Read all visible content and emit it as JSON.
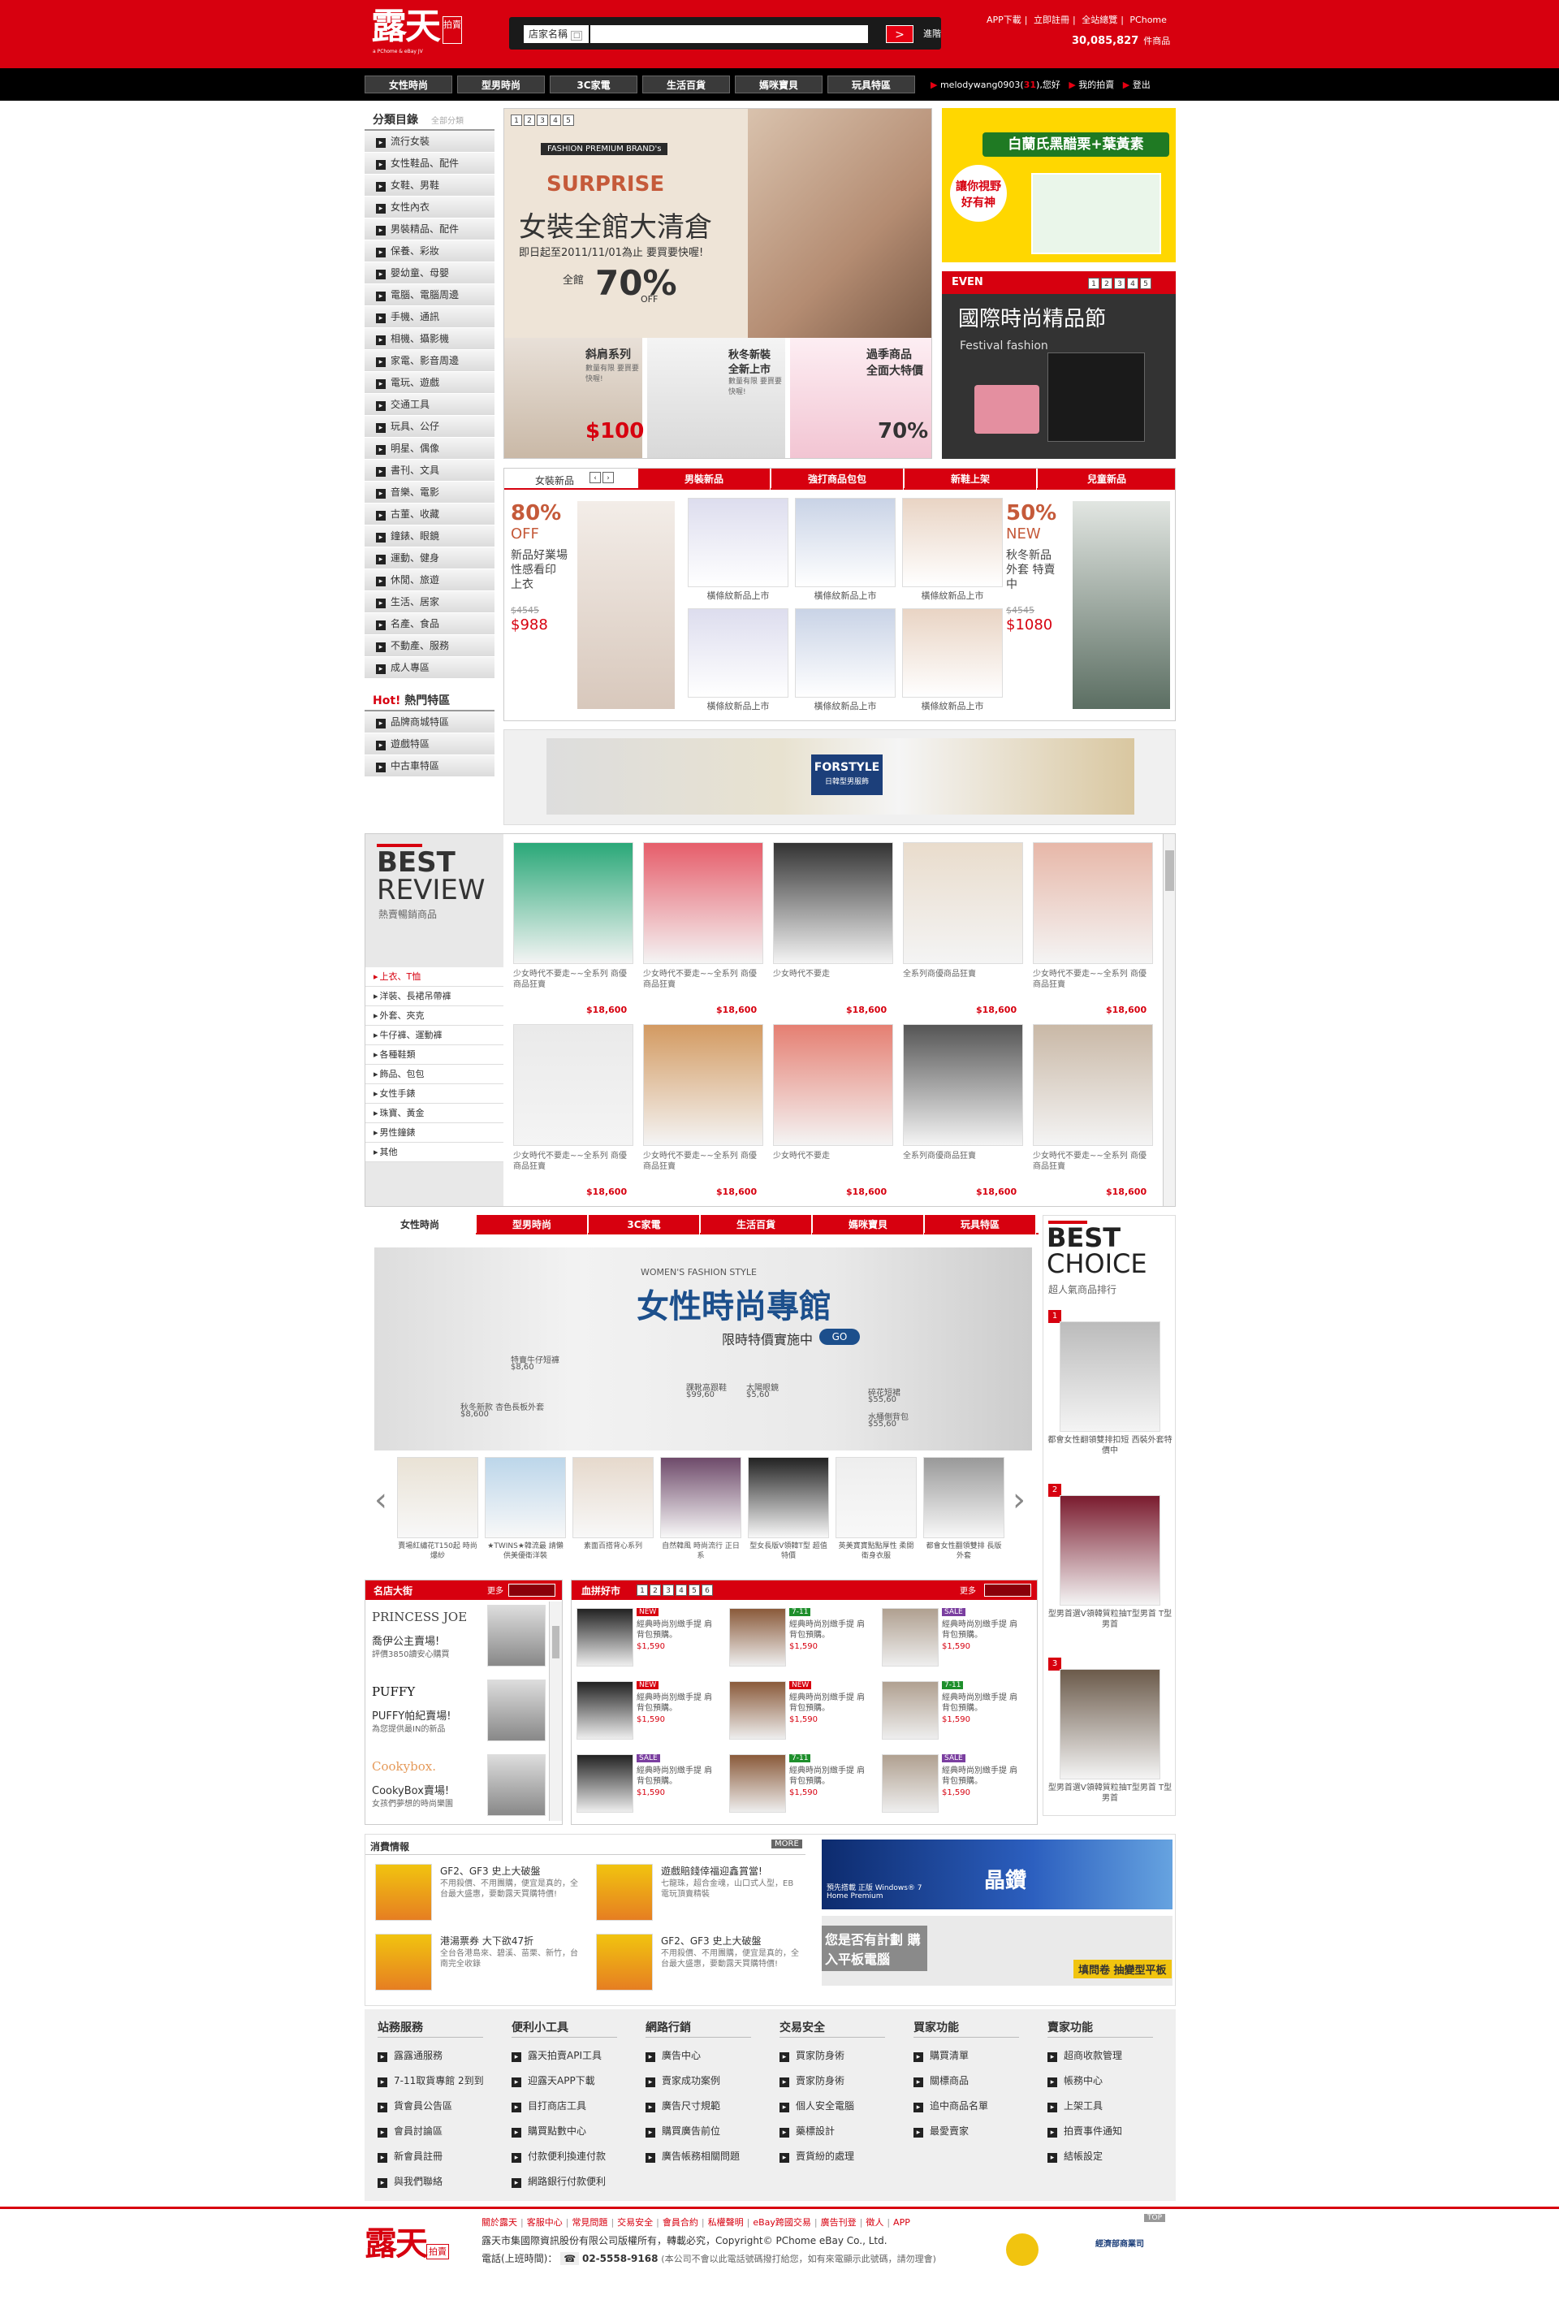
{
  "header": {
    "logo": "露天",
    "logo_box": "拍賣",
    "logo_sub": "a PChome & eBay JV",
    "search_scope": "店家名稱",
    "search_placeholder": "",
    "search_button": ">",
    "advanced": "進階",
    "top_links": [
      "APP下載",
      "立即註冊",
      "全站總覽",
      "PChome"
    ],
    "counter": "30,085,827",
    "counter_unit": "件商品"
  },
  "nav": {
    "tabs": [
      "女性時尚",
      "型男時尚",
      "3C家電",
      "生活百貨",
      "媽咪寶貝",
      "玩具特區"
    ],
    "user": "melodywang0903",
    "user_suffix": "(",
    "user_score": "31",
    "user_greet": "),您好",
    "my_auction": "我的拍賣",
    "logout": "登出"
  },
  "sidebar": {
    "title": "分類目錄",
    "all": "全部分類",
    "items": [
      "流行女裝",
      "女性鞋品、配件",
      "女鞋、男鞋",
      "女性內衣",
      "男裝精品、配件",
      "保養、彩妝",
      "嬰幼童、母嬰",
      "電腦、電腦周邊",
      "手機、通訊",
      "相機、攝影機",
      "家電、影音周邊",
      "電玩、遊戲",
      "交通工具",
      "玩具、公仔",
      "明星、偶像",
      "書刊、文具",
      "音樂、電影",
      "古董、收藏",
      "鐘錶、眼鏡",
      "運動、健身",
      "休閒、旅遊",
      "生活、居家",
      "名產、食品",
      "不動產、服務",
      "成人專區"
    ],
    "hot_title_a": "Hot!",
    "hot_title_b": "熱門特區",
    "hot_items": [
      "品牌商城特區",
      "遊戲特區",
      "中古車特區"
    ]
  },
  "banner": {
    "pager": [
      "1",
      "2",
      "3",
      "4",
      "5"
    ],
    "tagline": "FASHION PREMIUM BRAND's",
    "surprise": "SURPRISE",
    "headline": "女裝全館大清倉",
    "date": "即日起至2011/11/01為止 要買要快喔!",
    "pct_label": "全館",
    "pct": "70%",
    "pct_off": "OFF",
    "sub1": "斜肩系列",
    "sub1b": "數量有限 要買要快喔!",
    "sub1p": "$100",
    "sub2": "秋冬新裝",
    "sub2b": "全新上市",
    "sub2c": "數量有限 要買要快喔!",
    "sub3": "過季商品",
    "sub3b": "全面大特價",
    "sub3p": "70%",
    "ad_right": "白蘭氏黑醋栗+葉黃素",
    "ad_right_sub": "讓你視野 好有神",
    "even": "EVEN",
    "festival": "國際時尚精品節",
    "festival_sub": "Festival fashion"
  },
  "newitems": {
    "tabs": [
      "女裝新品",
      "男裝新品",
      "強打商品包包",
      "新鞋上架",
      "兒童新品"
    ],
    "left_pct": "80%",
    "left_off": "OFF",
    "left_text": "新品好業場 性感看印 上衣",
    "left_old": "$4545",
    "left_price": "$988",
    "right_pct": "50%",
    "right_new": "NEW",
    "right_text": "秋冬新品 外套 特賣中",
    "right_old": "$4545",
    "right_price": "$1080",
    "caption": "橫條紋新品上市"
  },
  "strip": {
    "brand": "FORSTYLE",
    "brand_sub": "日韓型男服飾"
  },
  "best_review": {
    "title1": "BEST",
    "title2": "REVIEW",
    "sub": "熱賣暢銷商品",
    "menu": [
      "上衣、T恤",
      "洋裝、長裙吊帶褲",
      "外套、夾克",
      "牛仔褲、運動褲",
      "各種鞋類",
      "飾品、包包",
      "女性手錶",
      "珠寶、黃金",
      "男性鐘錶",
      "其他"
    ],
    "caps": [
      "少女時代不要走~~全系列 商優商品狂賣",
      "少女時代不要走~~全系列 商優商品狂賣",
      "少女時代不要走",
      "全系列商優商品狂賣",
      "少女時代不要走~~全系列 商優商品狂賣"
    ],
    "price": "$18,600"
  },
  "women": {
    "tabs": [
      "女性時尚",
      "型男時尚",
      "3C家電",
      "生活百貨",
      "媽咪寶貝",
      "玩具特區"
    ],
    "style": "WOMEN'S FASHION STYLE",
    "title": "女性時尚專館",
    "sale": "限時特價實施中",
    "go": "GO",
    "items": [
      {
        "n": "特賣牛仔短褲",
        "p": "$8,60"
      },
      {
        "n": "秋冬新款 杏色長板外套",
        "p": "$8,600"
      },
      {
        "n": "踝靴高跟鞋",
        "p": "$99,60"
      },
      {
        "n": "太陽眼鏡",
        "p": "$5,60"
      },
      {
        "n": "碎花短裙",
        "p": "$55,60"
      },
      {
        "n": "水桶側背包",
        "p": "$55,60"
      }
    ],
    "carousel": [
      "賣場紅繡花T150起 時尚爆紗",
      "★TWINS★韓流最 請懶供美優衛洋裝",
      "素面百搭背心系列",
      "自然韓風 時尚流行 正日系",
      "型女長版V領韓T型 超值特價",
      "英美寶寶點點厚性 柔開衛身衣服",
      "都會女性翻領雙排 長版外套"
    ]
  },
  "best_choice": {
    "title1": "BEST",
    "title2": "CHOICE",
    "sub": "超人氣商品排行",
    "items": [
      {
        "rank": "1",
        "t": "都會女性翻領雙排扣短 西裝外套特價中"
      },
      {
        "rank": "2",
        "t": "型男首選V領韓質粒抽T型男首 T型男首"
      },
      {
        "rank": "3",
        "t": "型男首選V領韓質粒抽T型男首 T型男首"
      }
    ]
  },
  "shops": {
    "title": "名店大街",
    "more": "更多",
    "list": [
      {
        "brand": "PRINCESS JOE",
        "name": "喬伊公主賣場!",
        "desc": "評價3850讀安心購買"
      },
      {
        "brand": "PUFFY",
        "name": "PUFFY帕紀賣場!",
        "desc": "為您提供最IN的新品"
      },
      {
        "brand": "Cookybox.",
        "name": "CookyBox賣場!",
        "desc": "女孩們夢想的時尚樂園"
      }
    ]
  },
  "blood": {
    "title": "血拼好市",
    "pager": [
      "1",
      "2",
      "3",
      "4",
      "5",
      "6"
    ],
    "more": "更多",
    "desc": "經典時尚別緻手提 肩背包預購。",
    "price": "$1,590",
    "badges": [
      "NEW",
      "7-11",
      "SALE",
      "NEW",
      "NEW",
      "7-11",
      "SALE",
      "7-11",
      "SALE"
    ]
  },
  "news": {
    "title": "消費情報",
    "more": "MORE",
    "items": [
      {
        "t": "GF2、GF3 史上大破盤",
        "d": "不用殺價、不用團購，便宜是真的，全台最大盛惠，要動露天買購特價!"
      },
      {
        "t": "港湯票券 大下欲47折",
        "d": "全台各港島來、碧溪、苗栗、新竹，台南完全收錄"
      },
      {
        "t": "遊戲賠錢倖福迎鑫賞當!",
        "d": "七龍珠，超合金魂，山口式人型，EB電玩頂賣精裝"
      },
      {
        "t": "GF2、GF3 史上大破盤",
        "d": "不用殺價、不用團購，便宜是真的，全台最大盛惠，要動露天買購特價!"
      }
    ],
    "ad1": "晶鑽",
    "ad1_sub": "預先搭載 正版 Windows® 7 Home Premium",
    "ad2": "您是否有計劃 購入平板電腦",
    "ad2_sub": "填問卷 抽變型平板"
  },
  "footer_cols": [
    {
      "h": "站務服務",
      "items": [
        "露露通服務",
        "7-11取貨專館 2到到",
        "貨會員公告區",
        "會員討論區",
        "新會員註冊",
        "與我們聯絡"
      ]
    },
    {
      "h": "便利小工具",
      "items": [
        "露天拍賣API工具",
        "迎露天APP下載",
        "目打商店工具",
        "購買點數中心",
        "付款便利換連付款",
        "網路銀行付款便利"
      ]
    },
    {
      "h": "網路行銷",
      "items": [
        "廣告中心",
        "賣家成功案例",
        "廣告尺寸規範",
        "購買廣告前位",
        "廣告帳務相關問題"
      ]
    },
    {
      "h": "交易安全",
      "items": [
        "買家防身術",
        "賣家防身術",
        "個人安全電腦",
        "藥標設計",
        "賣貨紛的處理"
      ]
    },
    {
      "h": "買家功能",
      "items": [
        "購買清單",
        "關標商品",
        "追中商品名單",
        "最愛賣家"
      ]
    },
    {
      "h": "賣家功能",
      "items": [
        "超商收款管理",
        "帳務中心",
        "上架工具",
        "拍賣事件通知",
        "結帳設定"
      ]
    }
  ],
  "footer": {
    "links": [
      "關於露天",
      "客服中心",
      "常見問題",
      "交易安全",
      "會員合約",
      "私權聲明",
      "eBay跨國交易",
      "廣告刊登",
      "徵人",
      "APP"
    ],
    "top": "TOP",
    "company": "露天市集國際資訊股份有限公司版權所有，轉載必究，Copyright© PChome eBay Co., Ltd.",
    "phone_label": "電話(上班時間)：",
    "phone": "02-5558-9168",
    "phone_note": "(本公司不會以此電話號碼撥打給您，如有來電顯示此號碼，請勿理會)",
    "badge": "經濟部商業司"
  },
  "colors": {
    "brand_red": "#d7000f",
    "nav_black": "#000000"
  }
}
